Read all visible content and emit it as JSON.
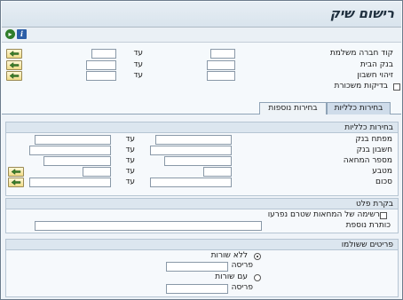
{
  "window": {
    "title": "רישום שיק"
  },
  "toolbar": {
    "info_icon": "info-icon",
    "execute_icon": "execute-icon"
  },
  "header_fields": [
    {
      "label": "קוד חברה משלמת",
      "to_label": "עד"
    },
    {
      "label": "בנק הבית",
      "to_label": "עד"
    },
    {
      "label": "זיהוי חשבון",
      "to_label": "עד"
    }
  ],
  "checks": {
    "label": "בדיקות משכורת"
  },
  "tabs": [
    {
      "label": "בחירות כלליות",
      "active": true
    },
    {
      "label": "בחירות נוספות",
      "active": false
    }
  ],
  "general": {
    "title": "בחירות כלליות",
    "fields": [
      {
        "label": "מפתח בנק",
        "to_label": "עד"
      },
      {
        "label": "חשבון בנק",
        "to_label": "עד"
      },
      {
        "label": "מספר המחאה",
        "to_label": "עד"
      },
      {
        "label": "מטבע",
        "to_label": "עד"
      },
      {
        "label": "סכום",
        "to_label": "עד"
      }
    ]
  },
  "output": {
    "title": "בקרת פלט",
    "list_checkbox": "רשימה של המחאות שטרם נפרעו",
    "extra_header": "כותרת נוספת"
  },
  "paid_items": {
    "title": "פריטים ששולמו",
    "option_without": "ללא שורות",
    "layout_1": "פריסה",
    "option_with": "עם שורות",
    "layout_2": "פריסה"
  }
}
